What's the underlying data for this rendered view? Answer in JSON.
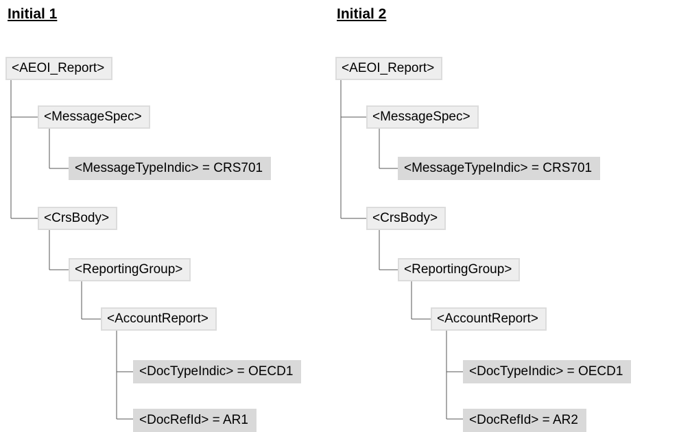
{
  "trees": [
    {
      "heading": "Initial 1",
      "nodes": {
        "root": "<AEOI_Report>",
        "message_spec": "<MessageSpec>",
        "message_type_indic": "<MessageTypeIndic> = CRS701",
        "crs_body": "<CrsBody>",
        "reporting_group": "<ReportingGroup>",
        "account_report": "<AccountReport>",
        "doc_type_indic": "<DocTypeIndic> = OECD1",
        "doc_ref_id": "<DocRefId> = AR1"
      }
    },
    {
      "heading": "Initial 2",
      "nodes": {
        "root": "<AEOI_Report>",
        "message_spec": "<MessageSpec>",
        "message_type_indic": "<MessageTypeIndic> = CRS701",
        "crs_body": "<CrsBody>",
        "reporting_group": "<ReportingGroup>",
        "account_report": "<AccountReport>",
        "doc_type_indic": "<DocTypeIndic> = OECD1",
        "doc_ref_id": "<DocRefId> = AR2"
      }
    }
  ],
  "colors": {
    "element_fill": "#eeeeee",
    "element_border": "#dcdcdc",
    "leaf_fill": "#d9d9d9",
    "connector": "#555555"
  }
}
